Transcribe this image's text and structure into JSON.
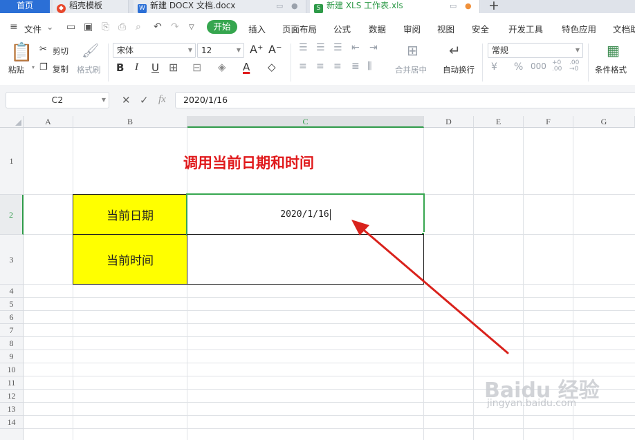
{
  "tabs": [
    {
      "label": "首页",
      "icon": "home-icon"
    },
    {
      "label": "稻壳模板",
      "icon": "docer-icon"
    },
    {
      "label": "新建 DOCX 文档.docx",
      "icon": "word-icon"
    },
    {
      "label": "新建 XLS 工作表.xls",
      "icon": "spreadsheet-icon"
    }
  ],
  "menu": {
    "file": "文件",
    "items": [
      "开始",
      "插入",
      "页面布局",
      "公式",
      "数据",
      "审阅",
      "视图",
      "安全",
      "开发工具",
      "特色应用",
      "文档助"
    ],
    "active": "开始"
  },
  "ribbon": {
    "paste": "粘贴",
    "cut": "剪切",
    "copy": "复制",
    "format_painter": "格式刷",
    "font_name": "宋体",
    "font_size": "12",
    "merge_center": "合并居中",
    "wrap_text": "自动换行",
    "number_format": "常规",
    "conditional_format": "条件格式"
  },
  "formula_bar": {
    "name_box": "C2",
    "formula": "2020/1/16"
  },
  "sheet": {
    "columns": [
      "A",
      "B",
      "C",
      "D",
      "E",
      "F",
      "G"
    ],
    "selected_column": "C",
    "rows": [
      "1",
      "2",
      "3",
      "4",
      "5",
      "6",
      "7",
      "8",
      "9",
      "10",
      "11",
      "12",
      "13",
      "14"
    ],
    "selected_row": "2",
    "title": "调用当前日期和时间",
    "label_date": "当前日期",
    "label_time": "当前时间",
    "value_date": "2020/1/16",
    "value_time": ""
  },
  "colors": {
    "accent_green": "#36a64f",
    "title_red": "#e0191b",
    "label_fill": "#ffff00",
    "annotation_arrow": "#d9221c"
  },
  "watermark": {
    "main": "Baidu 经验",
    "sub": "jingyan.baidu.com"
  }
}
